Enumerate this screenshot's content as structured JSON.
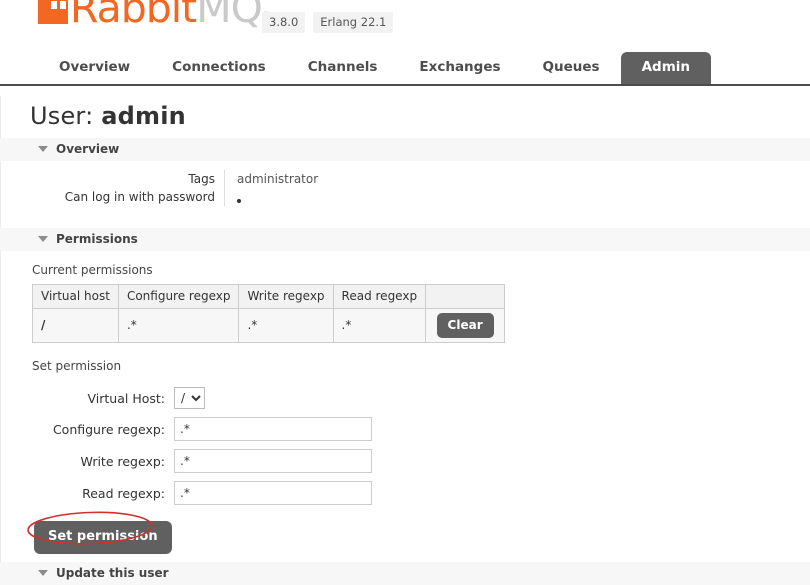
{
  "header": {
    "logo_primary": "Rabbit",
    "logo_secondary": "MQ",
    "logo_tm": "™",
    "version": "3.8.0",
    "erlang_version": "Erlang 22.1"
  },
  "nav": {
    "tabs": [
      {
        "label": "Overview",
        "active": false
      },
      {
        "label": "Connections",
        "active": false
      },
      {
        "label": "Channels",
        "active": false
      },
      {
        "label": "Exchanges",
        "active": false
      },
      {
        "label": "Queues",
        "active": false
      },
      {
        "label": "Admin",
        "active": true
      }
    ]
  },
  "page": {
    "title_prefix": "User:",
    "title_user": "admin"
  },
  "overview": {
    "section_label": "Overview",
    "rows": [
      {
        "label": "Tags",
        "value": "administrator"
      },
      {
        "label": "Can log in with password",
        "value": "•"
      }
    ]
  },
  "permissions": {
    "section_label": "Permissions",
    "current_label": "Current permissions",
    "table": {
      "columns": [
        "Virtual host",
        "Configure regexp",
        "Write regexp",
        "Read regexp",
        ""
      ],
      "rows": [
        {
          "virtual_host": "/",
          "configure_regexp": ".*",
          "write_regexp": ".*",
          "read_regexp": ".*",
          "action_label": "Clear"
        }
      ]
    },
    "set_label": "Set permission",
    "form": {
      "virtual_host_label": "Virtual Host:",
      "virtual_host_value": "/",
      "virtual_host_options": [
        "/"
      ],
      "configure_label": "Configure regexp:",
      "configure_value": ".*",
      "write_label": "Write regexp:",
      "write_value": ".*",
      "read_label": "Read regexp:",
      "read_value": ".*",
      "submit_label": "Set permission"
    }
  },
  "bottom": {
    "section_label": "Update this user"
  },
  "colors": {
    "brand_orange": "#f26722",
    "logo_gray": "#c9c9c9",
    "tab_active_bg": "#606060",
    "button_bg": "#606060",
    "section_bg": "#f7f7f7",
    "annotation_red": "#d0312d"
  }
}
